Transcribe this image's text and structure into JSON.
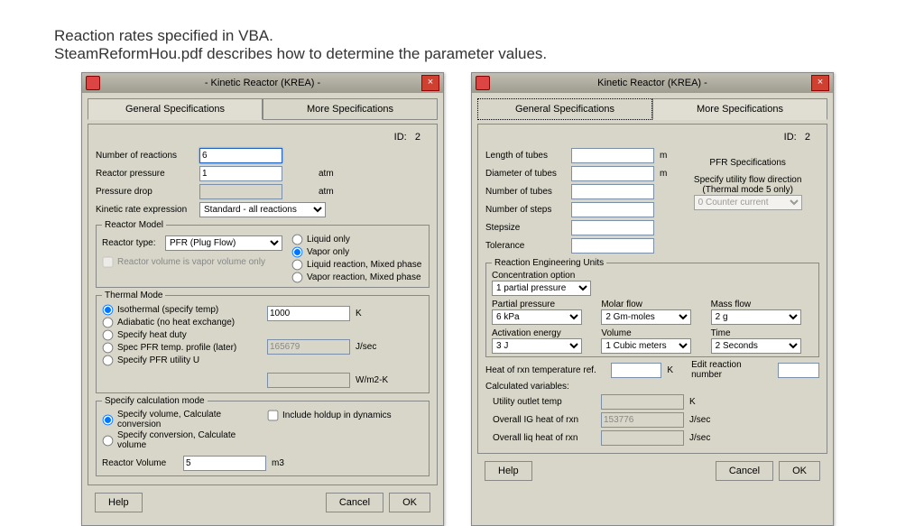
{
  "caption": {
    "line1": "Reaction rates specified in VBA.",
    "line2": "SteamReformHou.pdf describes how to determine the parameter values."
  },
  "dialog1": {
    "title": " - Kinetic Reactor (KREA) - ",
    "tabs": {
      "general": "General Specifications",
      "more": "More Specifications"
    },
    "id_label": "ID:",
    "id_value": "2",
    "num_reactions_label": "Number of reactions",
    "num_reactions_value": "6",
    "pressure_label": "Reactor pressure",
    "pressure_value": "1",
    "pressure_unit": "atm",
    "pdrop_label": "Pressure drop",
    "pdrop_value": "",
    "pdrop_unit": "atm",
    "kinetic_label": "Kinetic rate expression",
    "kinetic_value": "Standard - all reactions",
    "reactor_model_legend": "Reactor Model",
    "reactor_type_label": "Reactor type:",
    "reactor_type_value": "PFR (Plug Flow)",
    "vapor_only_check": "Reactor volume is vapor volume only",
    "phases": {
      "liquid": "Liquid only",
      "vapor": "Vapor only",
      "liqmix": "Liquid reaction, Mixed phase",
      "vapmix": "Vapor reaction, Mixed phase"
    },
    "thermal_legend": "Thermal Mode",
    "thermal": {
      "iso": "Isothermal (specify temp)",
      "adia": "Adiabatic (no heat exchange)",
      "heatduty": "Specify heat duty",
      "specpfr": "Spec PFR temp. profile (later)",
      "pfru": "Specify PFR utility U"
    },
    "temp_value": "1000",
    "temp_unit": "K",
    "heatduty_value": "165679",
    "heatduty_unit": "J/sec",
    "wmk_unit": "W/m2-K",
    "calcmode_legend": "Specify calculation mode",
    "calc": {
      "vol": "Specify volume, Calculate conversion",
      "conv": "Specify conversion, Calculate volume"
    },
    "holdup": "Include holdup in dynamics",
    "rvol_label": "Reactor Volume",
    "rvol_value": "5",
    "rvol_unit": "m3",
    "btn": {
      "help": "Help",
      "cancel": "Cancel",
      "ok": "OK"
    }
  },
  "dialog2": {
    "title": "Kinetic Reactor (KREA) - ",
    "tabs": {
      "general": "General Specifications",
      "more": "More Specifications"
    },
    "id_label": "ID:",
    "id_value": "2",
    "length_label": "Length of tubes",
    "length_unit": "m",
    "diameter_label": "Diameter of tubes",
    "diameter_unit": "m",
    "numtubes_label": "Number of tubes",
    "numsteps_label": "Number of steps",
    "stepsize_label": "Stepsize",
    "tolerance_label": "Tolerance",
    "pfrspec_label": "PFR Specifications",
    "flowdir_label": "Specify utility flow direction\n(Thermal mode 5 only)",
    "flowdir_value": "0 Counter current",
    "reu_legend": "Reaction Engineering Units",
    "conc_label": "Concentration option",
    "conc_value": "1 partial pressure",
    "partial_label": "Partial pressure",
    "partial_value": "6 kPa",
    "molar_label": "Molar flow",
    "molar_value": "2 Gm-moles",
    "mass_label": "Mass flow",
    "mass_value": "2  g",
    "act_label": "Activation energy",
    "act_value": "3 J",
    "vol_label": "Volume",
    "vol_value": "1 Cubic meters",
    "time_label": "Time",
    "time_value": "2 Seconds",
    "heat_ref_label": "Heat of rxn temperature ref.",
    "heat_ref_unit": "K",
    "edit_rxn_label": "Edit reaction number",
    "calcvar_label": "Calculated variables:",
    "utility_label": "Utility outlet temp",
    "utility_unit": "K",
    "igheat_label": "Overall  IG heat of rxn",
    "igheat_value": "153776",
    "igheat_unit": "J/sec",
    "liqheat_label": "Overall liq heat of rxn",
    "liqheat_unit": "J/sec",
    "btn": {
      "help": "Help",
      "cancel": "Cancel",
      "ok": "OK"
    }
  }
}
